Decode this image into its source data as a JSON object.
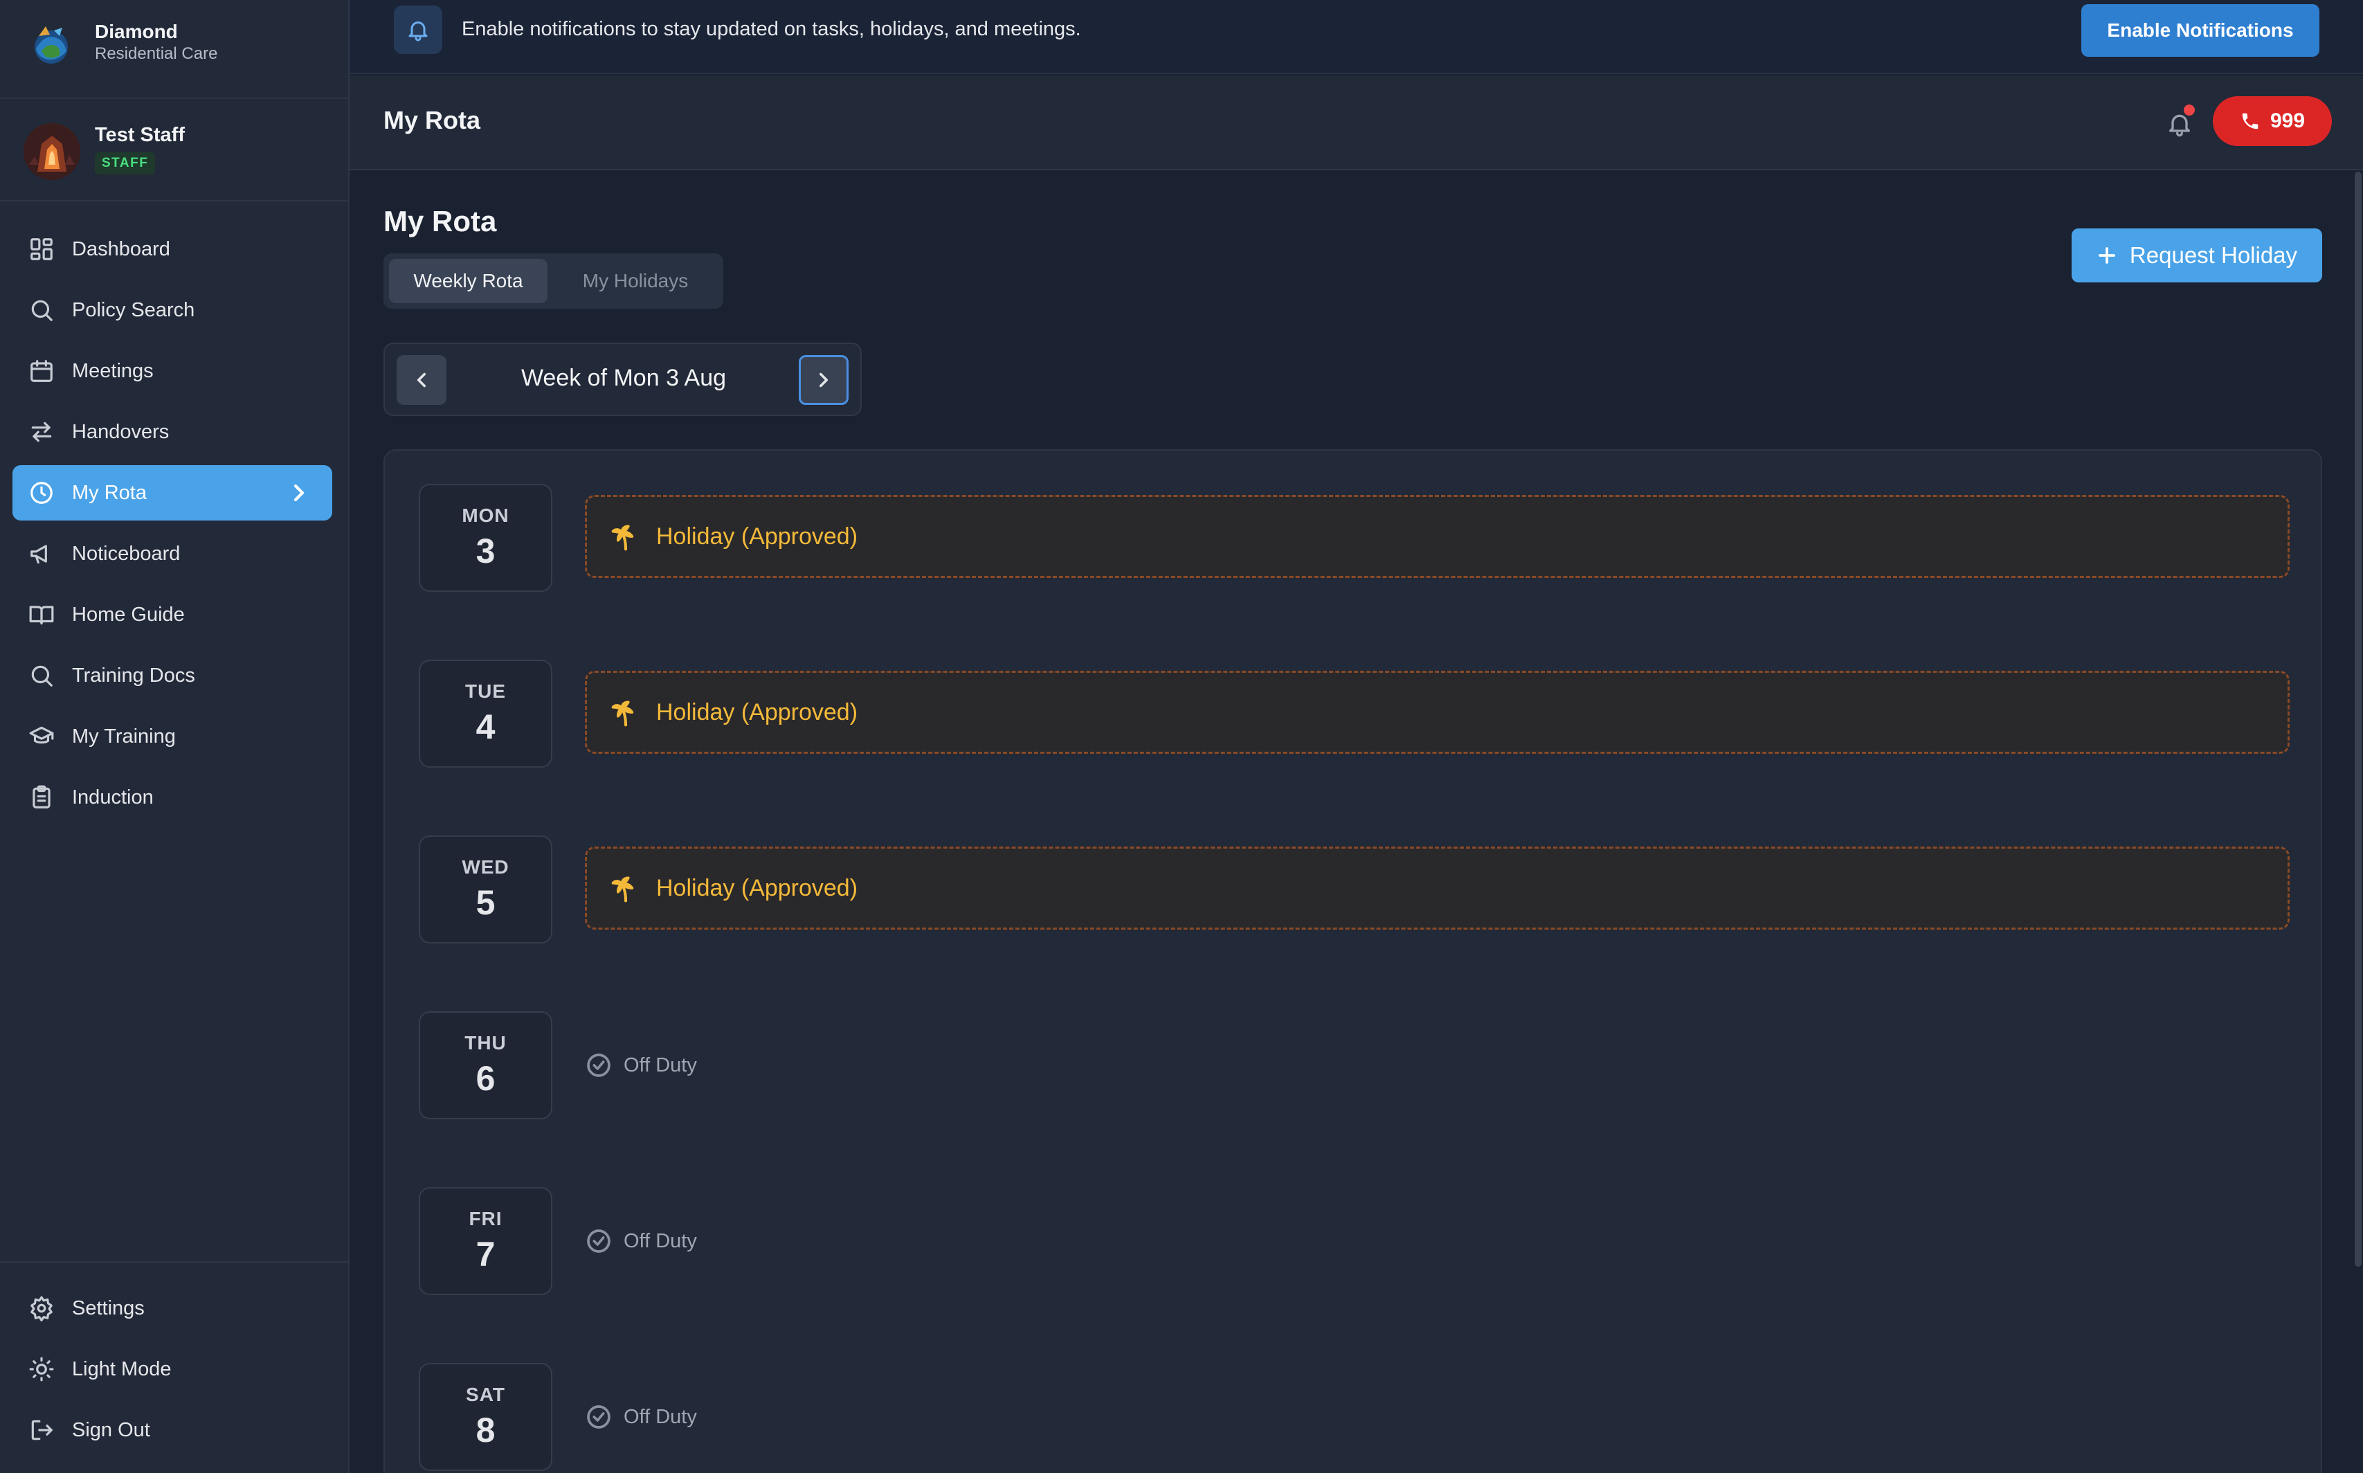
{
  "brand": {
    "name": "Diamond",
    "subtitle": "Residential Care",
    "logo_icon": "diamond-logo-icon"
  },
  "user": {
    "name": "Test Staff",
    "role": "STAFF"
  },
  "sidebar": {
    "items": [
      {
        "label": "Dashboard",
        "icon": "dashboard-icon"
      },
      {
        "label": "Policy Search",
        "icon": "search-icon"
      },
      {
        "label": "Meetings",
        "icon": "calendar-icon"
      },
      {
        "label": "Handovers",
        "icon": "swap-arrows-icon"
      },
      {
        "label": "My Rota",
        "icon": "clock-icon",
        "active": true
      },
      {
        "label": "Noticeboard",
        "icon": "megaphone-icon"
      },
      {
        "label": "Home Guide",
        "icon": "book-open-icon"
      },
      {
        "label": "Training Docs",
        "icon": "search-icon"
      },
      {
        "label": "My Training",
        "icon": "graduation-cap-icon"
      },
      {
        "label": "Induction",
        "icon": "clipboard-icon"
      }
    ],
    "footer": [
      {
        "label": "Settings",
        "icon": "gear-icon"
      },
      {
        "label": "Light Mode",
        "icon": "sun-icon"
      },
      {
        "label": "Sign Out",
        "icon": "sign-out-icon"
      }
    ]
  },
  "banner": {
    "text": "Enable notifications to stay updated on tasks, holidays, and meetings.",
    "button": "Enable Notifications"
  },
  "header": {
    "title": "My Rota",
    "emergency_button": "999"
  },
  "main": {
    "title": "My Rota",
    "tabs": [
      {
        "label": "Weekly Rota",
        "active": true
      },
      {
        "label": "My Holidays",
        "active": false
      }
    ],
    "request_button": "Request Holiday",
    "week_label": "Week of Mon 3 Aug",
    "days": [
      {
        "day": "MON",
        "date": "3",
        "status": "Holiday (Approved)",
        "type": "holiday"
      },
      {
        "day": "TUE",
        "date": "4",
        "status": "Holiday (Approved)",
        "type": "holiday"
      },
      {
        "day": "WED",
        "date": "5",
        "status": "Holiday (Approved)",
        "type": "holiday"
      },
      {
        "day": "THU",
        "date": "6",
        "status": "Off Duty",
        "type": "off"
      },
      {
        "day": "FRI",
        "date": "7",
        "status": "Off Duty",
        "type": "off"
      },
      {
        "day": "SAT",
        "date": "8",
        "status": "Off Duty",
        "type": "off"
      }
    ]
  },
  "colors": {
    "accent": "#4aa3e8",
    "holiday_text": "#f5b93a",
    "emergency": "#dc2626",
    "background": "#1a2130"
  }
}
